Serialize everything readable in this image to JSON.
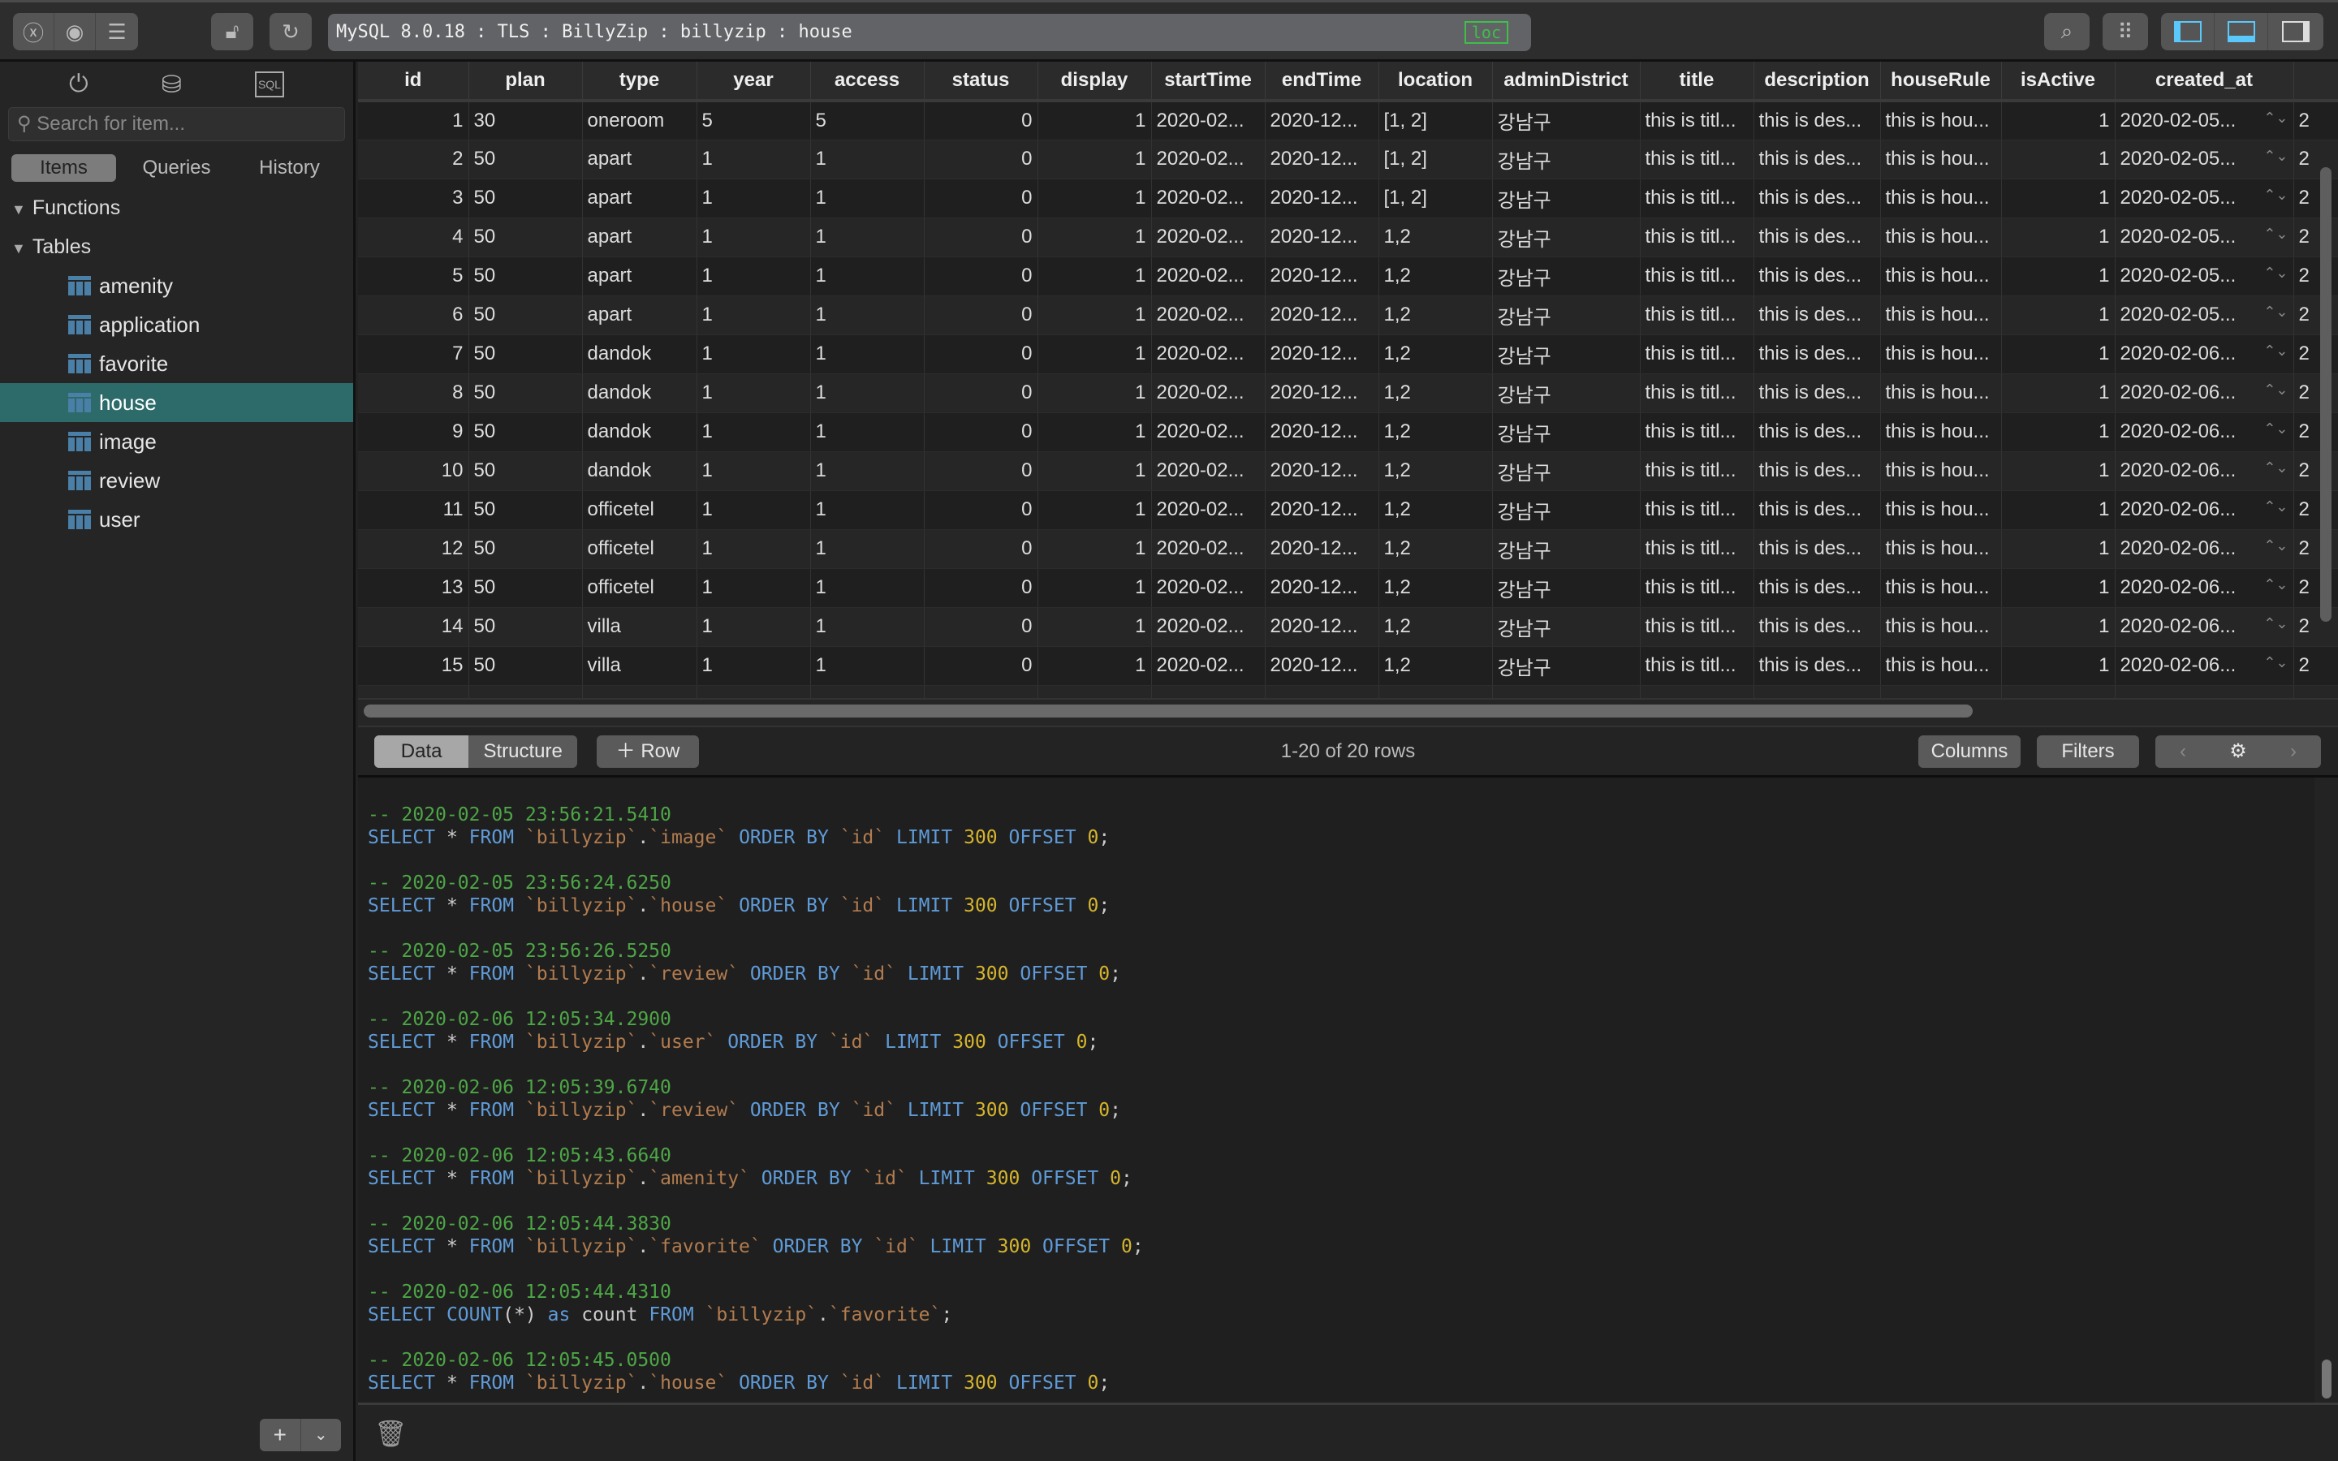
{
  "toolbar": {
    "address": "MySQL 8.0.18 : TLS : BillyZip : billyzip : house",
    "loc_badge": "loc"
  },
  "sidebar": {
    "search_placeholder": "Search for item...",
    "tabs": [
      "Items",
      "Queries",
      "History"
    ],
    "groups": {
      "functions": "Functions",
      "tables": "Tables"
    },
    "tables": [
      "amenity",
      "application",
      "favorite",
      "house",
      "image",
      "review",
      "user"
    ],
    "selected": "house"
  },
  "grid": {
    "columns": [
      "id",
      "plan",
      "type",
      "year",
      "access",
      "status",
      "display",
      "startTime",
      "endTime",
      "location",
      "adminDistrict",
      "title",
      "description",
      "houseRule",
      "isActive",
      "created_at",
      ""
    ],
    "rows": [
      [
        "1",
        "30",
        "oneroom",
        "5",
        "5",
        "0",
        "1",
        "2020-02...",
        "2020-12...",
        "[1, 2]",
        "강남구",
        "this is titl...",
        "this is des...",
        "this is hou...",
        "1",
        "2020-02-05...",
        "2"
      ],
      [
        "2",
        "50",
        "apart",
        "1",
        "1",
        "0",
        "1",
        "2020-02...",
        "2020-12...",
        "[1, 2]",
        "강남구",
        "this is titl...",
        "this is des...",
        "this is hou...",
        "1",
        "2020-02-05...",
        "2"
      ],
      [
        "3",
        "50",
        "apart",
        "1",
        "1",
        "0",
        "1",
        "2020-02...",
        "2020-12...",
        "[1, 2]",
        "강남구",
        "this is titl...",
        "this is des...",
        "this is hou...",
        "1",
        "2020-02-05...",
        "2"
      ],
      [
        "4",
        "50",
        "apart",
        "1",
        "1",
        "0",
        "1",
        "2020-02...",
        "2020-12...",
        "1,2",
        "강남구",
        "this is titl...",
        "this is des...",
        "this is hou...",
        "1",
        "2020-02-05...",
        "2"
      ],
      [
        "5",
        "50",
        "apart",
        "1",
        "1",
        "0",
        "1",
        "2020-02...",
        "2020-12...",
        "1,2",
        "강남구",
        "this is titl...",
        "this is des...",
        "this is hou...",
        "1",
        "2020-02-05...",
        "2"
      ],
      [
        "6",
        "50",
        "apart",
        "1",
        "1",
        "0",
        "1",
        "2020-02...",
        "2020-12...",
        "1,2",
        "강남구",
        "this is titl...",
        "this is des...",
        "this is hou...",
        "1",
        "2020-02-05...",
        "2"
      ],
      [
        "7",
        "50",
        "dandok",
        "1",
        "1",
        "0",
        "1",
        "2020-02...",
        "2020-12...",
        "1,2",
        "강남구",
        "this is titl...",
        "this is des...",
        "this is hou...",
        "1",
        "2020-02-06...",
        "2"
      ],
      [
        "8",
        "50",
        "dandok",
        "1",
        "1",
        "0",
        "1",
        "2020-02...",
        "2020-12...",
        "1,2",
        "강남구",
        "this is titl...",
        "this is des...",
        "this is hou...",
        "1",
        "2020-02-06...",
        "2"
      ],
      [
        "9",
        "50",
        "dandok",
        "1",
        "1",
        "0",
        "1",
        "2020-02...",
        "2020-12...",
        "1,2",
        "강남구",
        "this is titl...",
        "this is des...",
        "this is hou...",
        "1",
        "2020-02-06...",
        "2"
      ],
      [
        "10",
        "50",
        "dandok",
        "1",
        "1",
        "0",
        "1",
        "2020-02...",
        "2020-12...",
        "1,2",
        "강남구",
        "this is titl...",
        "this is des...",
        "this is hou...",
        "1",
        "2020-02-06...",
        "2"
      ],
      [
        "11",
        "50",
        "officetel",
        "1",
        "1",
        "0",
        "1",
        "2020-02...",
        "2020-12...",
        "1,2",
        "강남구",
        "this is titl...",
        "this is des...",
        "this is hou...",
        "1",
        "2020-02-06...",
        "2"
      ],
      [
        "12",
        "50",
        "officetel",
        "1",
        "1",
        "0",
        "1",
        "2020-02...",
        "2020-12...",
        "1,2",
        "강남구",
        "this is titl...",
        "this is des...",
        "this is hou...",
        "1",
        "2020-02-06...",
        "2"
      ],
      [
        "13",
        "50",
        "officetel",
        "1",
        "1",
        "0",
        "1",
        "2020-02...",
        "2020-12...",
        "1,2",
        "강남구",
        "this is titl...",
        "this is des...",
        "this is hou...",
        "1",
        "2020-02-06...",
        "2"
      ],
      [
        "14",
        "50",
        "villa",
        "1",
        "1",
        "0",
        "1",
        "2020-02...",
        "2020-12...",
        "1,2",
        "강남구",
        "this is titl...",
        "this is des...",
        "this is hou...",
        "1",
        "2020-02-06...",
        "2"
      ],
      [
        "15",
        "50",
        "villa",
        "1",
        "1",
        "0",
        "1",
        "2020-02...",
        "2020-12...",
        "1,2",
        "강남구",
        "this is titl...",
        "this is des...",
        "this is hou...",
        "1",
        "2020-02-06...",
        "2"
      ]
    ]
  },
  "footer": {
    "data_tab": "Data",
    "structure_tab": "Structure",
    "add_row": "Row",
    "row_count": "1-20 of 20 rows",
    "columns": "Columns",
    "filters": "Filters"
  },
  "log": [
    {
      "comment": "-- 2020-02-05 23:56:21.5410",
      "sql": "SELECT * FROM `billyzip`.`image` ORDER BY `id` LIMIT 300 OFFSET 0;"
    },
    {
      "comment": "-- 2020-02-05 23:56:24.6250",
      "sql": "SELECT * FROM `billyzip`.`house` ORDER BY `id` LIMIT 300 OFFSET 0;"
    },
    {
      "comment": "-- 2020-02-05 23:56:26.5250",
      "sql": "SELECT * FROM `billyzip`.`review` ORDER BY `id` LIMIT 300 OFFSET 0;"
    },
    {
      "comment": "-- 2020-02-06 12:05:34.2900",
      "sql": "SELECT * FROM `billyzip`.`user` ORDER BY `id` LIMIT 300 OFFSET 0;"
    },
    {
      "comment": "-- 2020-02-06 12:05:39.6740",
      "sql": "SELECT * FROM `billyzip`.`review` ORDER BY `id` LIMIT 300 OFFSET 0;"
    },
    {
      "comment": "-- 2020-02-06 12:05:43.6640",
      "sql": "SELECT * FROM `billyzip`.`amenity` ORDER BY `id` LIMIT 300 OFFSET 0;"
    },
    {
      "comment": "-- 2020-02-06 12:05:44.3830",
      "sql": "SELECT * FROM `billyzip`.`favorite` ORDER BY `id` LIMIT 300 OFFSET 0;"
    },
    {
      "comment": "-- 2020-02-06 12:05:44.4310",
      "sql": "SELECT COUNT(*) as count FROM `billyzip`.`favorite`;"
    },
    {
      "comment": "-- 2020-02-06 12:05:45.0500",
      "sql": "SELECT * FROM `billyzip`.`house` ORDER BY `id` LIMIT 300 OFFSET 0;"
    }
  ],
  "colors": {
    "accent": "#2d6a6a",
    "keyword": "#5f9bd8",
    "identifier": "#b27c4f",
    "number": "#d6b52d",
    "comment": "#4da646",
    "loc": "#3fbf4a"
  }
}
